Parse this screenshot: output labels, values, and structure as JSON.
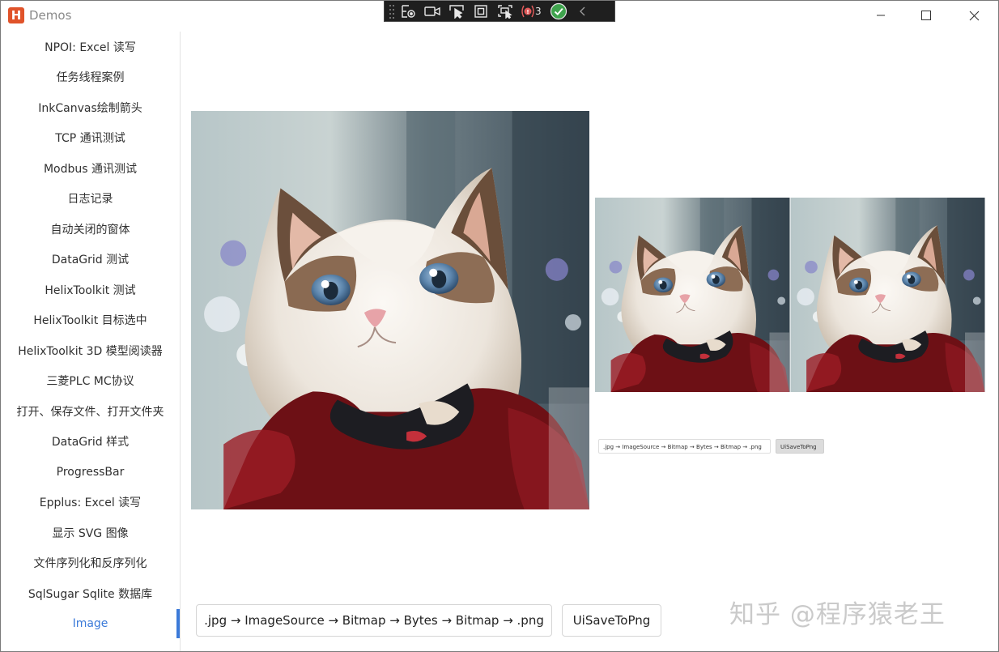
{
  "window": {
    "title": "Demos",
    "logo_letter": "H"
  },
  "debug_toolbar": {
    "binding_errors": "3"
  },
  "sidebar": {
    "items": [
      {
        "label": "NPOI: Excel 读写"
      },
      {
        "label": "任务线程案例"
      },
      {
        "label": "InkCanvas绘制箭头"
      },
      {
        "label": "TCP 通讯测试"
      },
      {
        "label": "Modbus 通讯测试"
      },
      {
        "label": "日志记录"
      },
      {
        "label": "自动关闭的窗体"
      },
      {
        "label": "DataGrid 测试"
      },
      {
        "label": "HelixToolkit 测试"
      },
      {
        "label": "HelixToolkit 目标选中"
      },
      {
        "label": "HelixToolkit 3D 模型阅读器"
      },
      {
        "label": "三菱PLC MC协议"
      },
      {
        "label": "打开、保存文件、打开文件夹"
      },
      {
        "label": "DataGrid 样式"
      },
      {
        "label": "ProgressBar"
      },
      {
        "label": "Epplus: Excel 读写"
      },
      {
        "label": "显示 SVG 图像"
      },
      {
        "label": "文件序列化和反序列化"
      },
      {
        "label": "SqlSugar Sqlite 数据库"
      },
      {
        "label": "Image"
      }
    ],
    "active_index": 19,
    "accent_color": "#3b7ad9"
  },
  "main": {
    "mini_convert_label": ".jpg → ImageSource → Bitmap → Bytes → Bitmap → .png",
    "mini_save_label": "UiSaveToPng",
    "convert_button_label": ".jpg → ImageSource → Bitmap → Bytes → Bitmap → .png",
    "save_button_label": "UiSaveToPng"
  },
  "watermark": "知乎 @程序猿老王"
}
